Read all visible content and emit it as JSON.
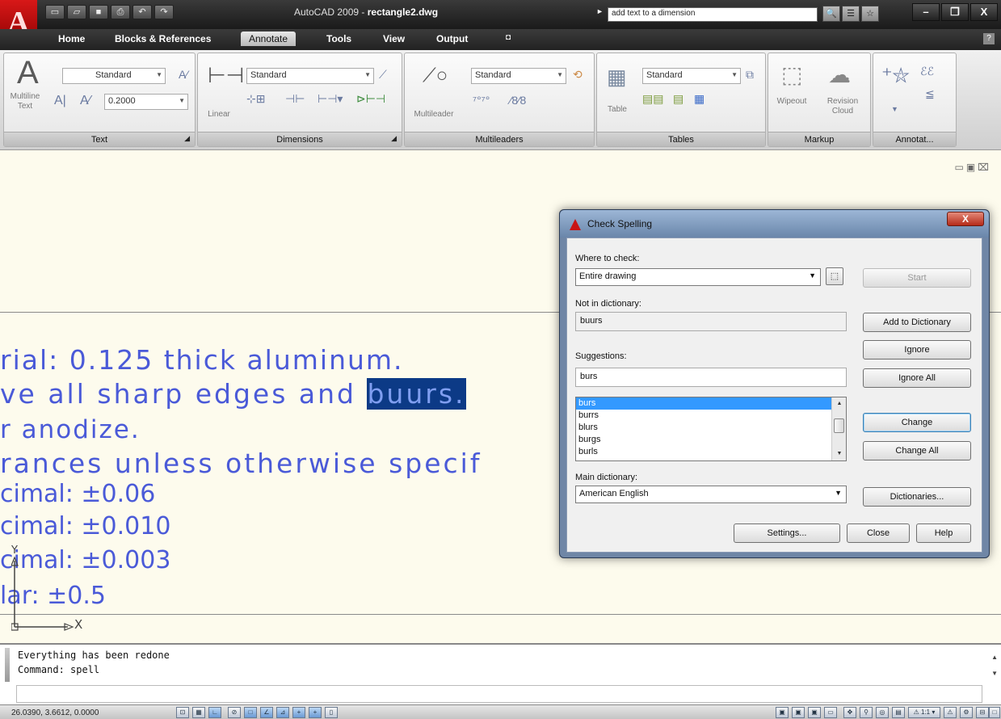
{
  "titlebar": {
    "title_prefix": "AutoCAD 2009 - ",
    "title_file": "rectangle2.dwg",
    "search_value": "add text to a dimension",
    "qat_icons": [
      "new-icon",
      "open-icon",
      "save-icon",
      "print-icon",
      "undo-icon",
      "redo-icon"
    ]
  },
  "tabs": [
    {
      "label": "Home"
    },
    {
      "label": "Blocks & References"
    },
    {
      "label": "Annotate",
      "active": true
    },
    {
      "label": "Tools"
    },
    {
      "label": "View"
    },
    {
      "label": "Output"
    }
  ],
  "ribbon": {
    "text_panel": {
      "label": "Text",
      "big_button": "Multiline\nText",
      "style_value": "Standard",
      "height_value": "0.2000"
    },
    "dimensions_panel": {
      "label": "Dimensions",
      "big_button": "Linear",
      "style_value": "Standard"
    },
    "multileaders_panel": {
      "label": "Multileaders",
      "big_button": "Multileader",
      "style_value": "Standard"
    },
    "tables_panel": {
      "label": "Tables",
      "big_button": "Table",
      "style_value": "Standard"
    },
    "markup_panel": {
      "label": "Markup",
      "wipeout": "Wipeout",
      "revision_cloud": "Revision\nCloud"
    },
    "annot_panel": {
      "label": "Annotat..."
    }
  },
  "drawing": {
    "lines": [
      {
        "text": "rial: 0.125 thick aluminum."
      },
      {
        "pre": "ve all sharp edges and ",
        "hl": "buurs."
      },
      {
        "text": "r anodize."
      },
      {
        "text": "rances unless otherwise specif"
      },
      {
        "text": "cimal: ±0.06"
      },
      {
        "text": "cimal: ±0.010"
      },
      {
        "text": "cimal: ±0.003"
      },
      {
        "text": "lar: ±0.5"
      }
    ],
    "ucs_x": "X",
    "ucs_y": "Y"
  },
  "dialog": {
    "title": "Check Spelling",
    "where_label": "Where to check:",
    "where_value": "Entire drawing",
    "start_label": "Start",
    "not_in_dict_label": "Not in dictionary:",
    "not_in_dict_value": "buurs",
    "add_to_dict_label": "Add to Dictionary",
    "ignore_label": "Ignore",
    "ignore_all_label": "Ignore All",
    "suggestions_label": "Suggestions:",
    "suggestion_value": "burs",
    "suggestion_list": [
      "burs",
      "burrs",
      "blurs",
      "burgs",
      "burls"
    ],
    "change_label": "Change",
    "change_all_label": "Change All",
    "main_dict_label": "Main dictionary:",
    "main_dict_value": "American English",
    "dictionaries_label": "Dictionaries...",
    "settings_label": "Settings...",
    "close_label": "Close",
    "help_label": "Help"
  },
  "command": {
    "history": [
      "Everything has been redone",
      "Command: spell"
    ]
  },
  "status": {
    "coords": "26.0390, 3.6612, 0.0000"
  }
}
